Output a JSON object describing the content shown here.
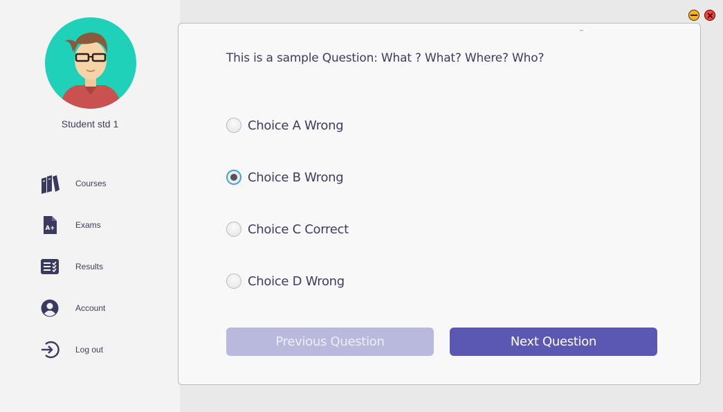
{
  "user": {
    "name": "Student std 1"
  },
  "nav": {
    "items": [
      {
        "label": "Courses",
        "icon": "books-icon"
      },
      {
        "label": "Exams",
        "icon": "exam-grade-icon"
      },
      {
        "label": "Results",
        "icon": "results-list-icon"
      },
      {
        "label": "Account",
        "icon": "account-icon"
      },
      {
        "label": "Log out",
        "icon": "logout-icon"
      }
    ]
  },
  "window": {
    "minimize_icon": "minimize-icon",
    "close_icon": "close-icon"
  },
  "question": {
    "text": "This is a sample Question: What ? What? Where? Who?",
    "choices": [
      {
        "label": "Choice A Wrong",
        "selected": false
      },
      {
        "label": "Choice B Wrong",
        "selected": true
      },
      {
        "label": "Choice C Correct",
        "selected": false
      },
      {
        "label": "Choice D Wrong",
        "selected": false
      }
    ]
  },
  "buttons": {
    "previous": "Previous Question",
    "next": "Next Question"
  },
  "colors": {
    "accent": "#5b58b4",
    "accent_disabled": "#b9b9de",
    "avatar_bg": "#1fd1b8",
    "radio_selected_ring": "#3aa3dc",
    "icon": "#3a3960"
  }
}
